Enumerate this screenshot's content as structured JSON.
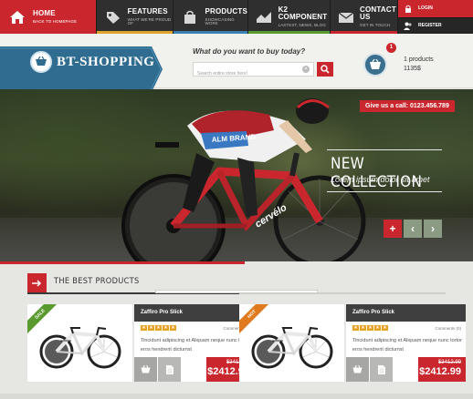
{
  "nav": {
    "items": [
      {
        "title": "HOME",
        "subtitle": "BACK TO HOMEPAGE",
        "icon": "home-icon"
      },
      {
        "title": "FEATURES",
        "subtitle": "WHAT WE'RE PROUD OF",
        "icon": "tag-icon"
      },
      {
        "title": "PRODUCTS",
        "subtitle": "SHOWCASING WORK",
        "icon": "bag-icon"
      },
      {
        "title": "K2 COMPONENT",
        "subtitle": "LASTEST, NEWS, BLOG",
        "icon": "chart-icon"
      },
      {
        "title": "CONTACT US",
        "subtitle": "GET IN TOUCH",
        "icon": "mail-icon"
      }
    ],
    "login_label": "LOGIN",
    "register_label": "REGISTER",
    "bar_colors": [
      "#c9272d",
      "#e0a32a",
      "#3a7fb0",
      "#5a9a2e",
      "#c9272d"
    ]
  },
  "header": {
    "logo_text": "BT-SHOPPING",
    "search_question": "What do you want to buy today?",
    "search_placeholder": "Search entire store here!",
    "cart_count": "1",
    "cart_products": "1 products",
    "cart_total": "1135$"
  },
  "hero": {
    "phone": "Give us a call:  0123.456.789",
    "title": "NEW COLLECTION",
    "subtitle": "Lorem ipsum dolor sit amet",
    "plus_label": "+",
    "prev_label": "‹",
    "next_label": "›",
    "jersey_text": "ALM BRAND",
    "bike_brand": "cervélo"
  },
  "section": {
    "title": "THE BEST PRODUCTS"
  },
  "products": [
    {
      "badge": "SALE",
      "badge_color": "#5a9a2e",
      "name": "Zaffiro Pro Slick",
      "comments": "Comments (0)",
      "description": "Tincidunt adipiscing et Aliquam neque nunc tortor eros hendrerit dictumst",
      "old_price": "$3412.99",
      "price": "$2412.99",
      "rating": 5
    },
    {
      "badge": "HOT",
      "badge_color": "#e07a1f",
      "name": "Zaffiro Pro Slick",
      "comments": "Comments (0)",
      "description": "Tincidunt adipiscing et Aliquam neque nunc tortor eros hendrerit dictumst",
      "old_price": "$3412.99",
      "price": "$2412.99",
      "rating": 5
    }
  ],
  "colors": {
    "accent": "#c9272d",
    "logo_blue": "#2f6c8f",
    "dark": "#2f2f2f"
  }
}
